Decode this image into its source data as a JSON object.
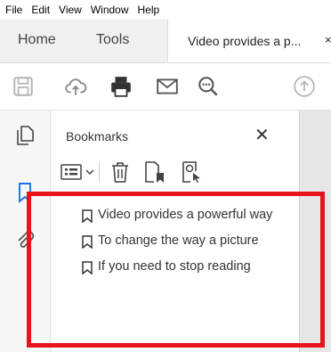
{
  "menu": [
    "File",
    "Edit",
    "View",
    "Window",
    "Help"
  ],
  "tabs": {
    "home": "Home",
    "tools": "Tools",
    "document": "Video provides a p...",
    "close_glyph": "×"
  },
  "panel": {
    "title": "Bookmarks",
    "close_glyph": "✕",
    "bookmarks": [
      "Video provides a powerful way",
      "To change the way a picture",
      "If you need to stop reading"
    ]
  },
  "icons": {
    "toolbar": [
      "save-icon",
      "upload-cloud-icon",
      "print-icon",
      "email-icon",
      "zoom-icon",
      "scroll-up-icon"
    ],
    "rail": [
      "pages-icon",
      "bookmark-icon",
      "attachment-icon"
    ],
    "panel_tools": [
      "options-icon",
      "delete-icon",
      "new-bookmark-icon",
      "find-bookmark-icon"
    ]
  },
  "colors": {
    "highlight": "#e8141c",
    "accent": "#1a73e8"
  }
}
